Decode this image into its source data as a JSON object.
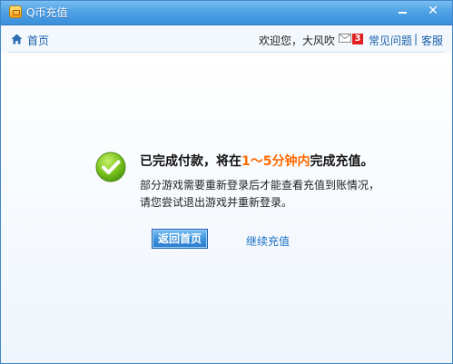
{
  "window": {
    "title": "Q币充值"
  },
  "nav": {
    "home": "首页",
    "welcome": "欢迎您，大风吹",
    "mail_count": "3",
    "faq": "常见问题",
    "separator": "|",
    "service": "客服"
  },
  "main": {
    "headline_prefix": "已完成付款，将在",
    "headline_highlight": "1～5分钟内",
    "headline_suffix": "完成充值。",
    "note_line1": "部分游戏需要重新登录后才能查看充值到账情况，",
    "note_line2": "请您尝试退出游戏并重新登录。",
    "back_button": "返回首页",
    "continue_link": "继续充值"
  },
  "colors": {
    "accent": "#3b8fdc",
    "highlight": "#ff6a00",
    "link": "#1a5fa8"
  },
  "icons": [
    "app-icon",
    "minimize-icon",
    "close-icon",
    "home-icon",
    "mail-icon",
    "check-icon"
  ]
}
